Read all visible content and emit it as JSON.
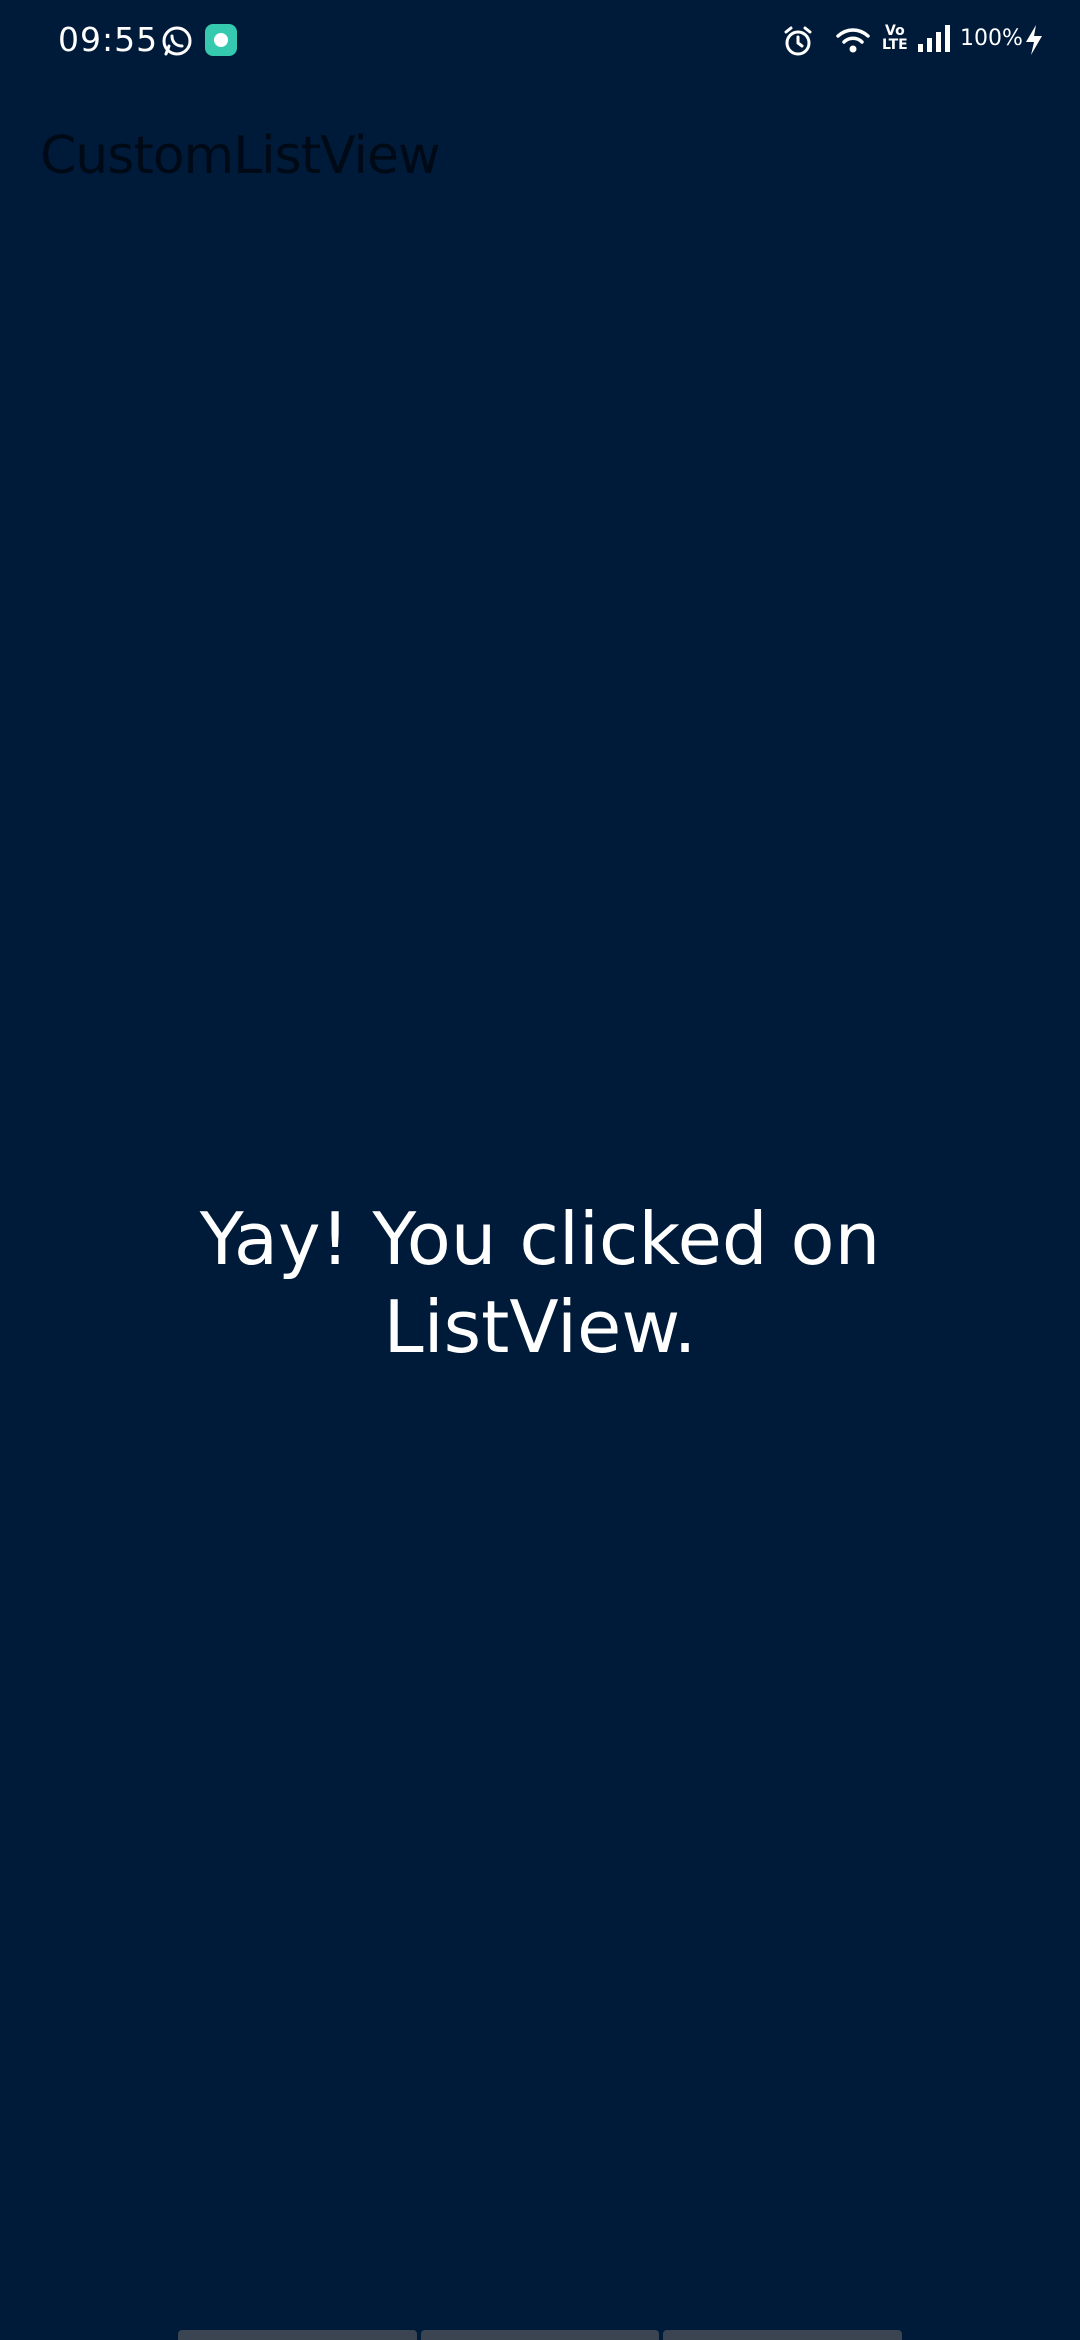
{
  "status_bar": {
    "time": "09:55",
    "network": "Vo\nLTE",
    "battery": "100%",
    "icons": [
      "whatsapp-icon",
      "app-notification-icon",
      "alarm-icon",
      "wifi-icon",
      "volte-icon",
      "signal-icon",
      "charging-icon"
    ]
  },
  "app": {
    "title": "CustomListView"
  },
  "main": {
    "message_line1": "Yay! You clicked on",
    "message_line2": "ListView."
  },
  "colors": {
    "background": "#001b3a",
    "text": "#ffffff",
    "title": "#000a16"
  }
}
